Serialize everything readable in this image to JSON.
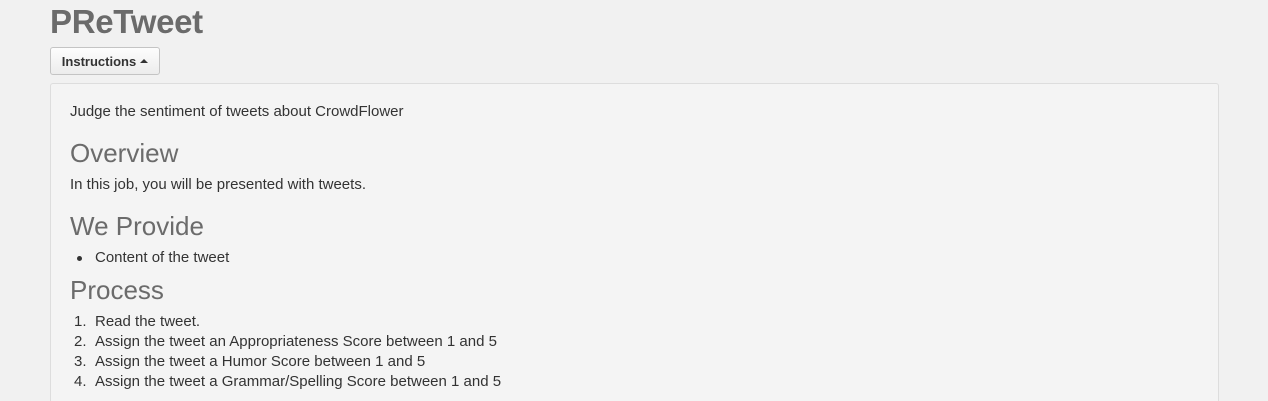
{
  "app": {
    "title": "PReTweet"
  },
  "toolbar": {
    "instructions_label": "Instructions",
    "instructions_icon": "caret-up-icon"
  },
  "instructions": {
    "intro": "Judge the sentiment of tweets about CrowdFlower",
    "overview": {
      "heading": "Overview",
      "text": "In this job, you will be presented with tweets."
    },
    "we_provide": {
      "heading": "We Provide",
      "items": [
        "Content of the tweet"
      ]
    },
    "process": {
      "heading": "Process",
      "steps": [
        {
          "num": "1.",
          "text": "Read the tweet."
        },
        {
          "num": "2.",
          "text": "Assign the tweet an Appropriateness Score between 1 and 5"
        },
        {
          "num": "3.",
          "text": "Assign the tweet a Humor Score between 1 and 5"
        },
        {
          "num": "4.",
          "text": "Assign the tweet a Grammar/Spelling Score between 1 and 5"
        }
      ]
    }
  }
}
